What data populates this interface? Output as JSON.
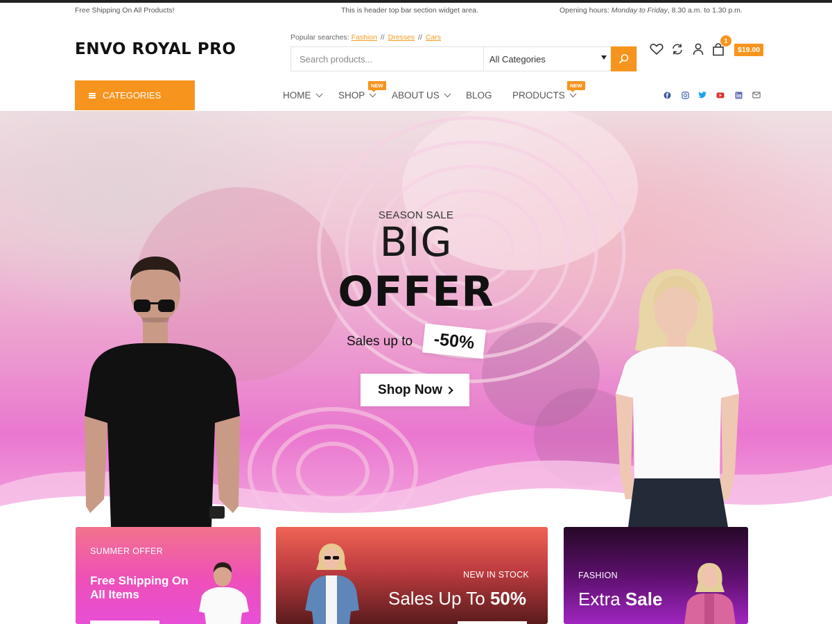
{
  "topbar": {
    "left": "Free Shipping On All Products!",
    "center": "This is header top bar section widget area.",
    "right_prefix": "Opening hours: ",
    "right_italic": "Monday to Friday",
    "right_suffix": ", 8.30 a.m. to 1.30 p.m."
  },
  "header": {
    "logo": "ENVO ROYAL PRO",
    "popular_label": "Popular searches:",
    "popular_links": [
      "Fashion",
      "Dresses",
      "Cars"
    ],
    "popular_sep": "//",
    "search_placeholder": "Search products...",
    "category_selected": "All Categories",
    "cart_count": "1",
    "cart_total": "$19.00"
  },
  "icons": {
    "search": "search-icon",
    "wishlist": "heart-icon",
    "compare": "refresh-icon",
    "account": "user-icon",
    "cart": "shopping-bag-icon"
  },
  "nav": {
    "categories_label": "CATEGORIES",
    "items": [
      {
        "label": "HOME",
        "dropdown": true
      },
      {
        "label": "SHOP",
        "dropdown": true,
        "badge": "NEW"
      },
      {
        "label": "ABOUT US",
        "dropdown": true
      },
      {
        "label": "BLOG",
        "dropdown": false
      },
      {
        "label": "PRODUCTS",
        "dropdown": true,
        "badge": "NEW"
      }
    ],
    "social": [
      "facebook-icon",
      "instagram-icon",
      "twitter-icon",
      "youtube-icon",
      "linkedin-icon",
      "email-icon"
    ]
  },
  "hero": {
    "eyebrow": "SEASON SALE",
    "line1": "BIG",
    "line2": "OFFER",
    "sales_text": "Sales up to",
    "discount": "-50%",
    "cta": "Shop Now"
  },
  "promos": [
    {
      "eyebrow": "SUMMER OFFER",
      "headline_line1": "Free Shipping On",
      "headline_line2": "All Items"
    },
    {
      "eyebrow": "NEW IN STOCK",
      "headline_plain": "Sales Up To ",
      "headline_bold": "50%"
    },
    {
      "eyebrow": "FASHION",
      "headline_plain": "Extra ",
      "headline_bold": "Sale"
    }
  ],
  "colors": {
    "accent": "#f7941d",
    "text_dark": "#111111",
    "nav_text": "#555555"
  }
}
